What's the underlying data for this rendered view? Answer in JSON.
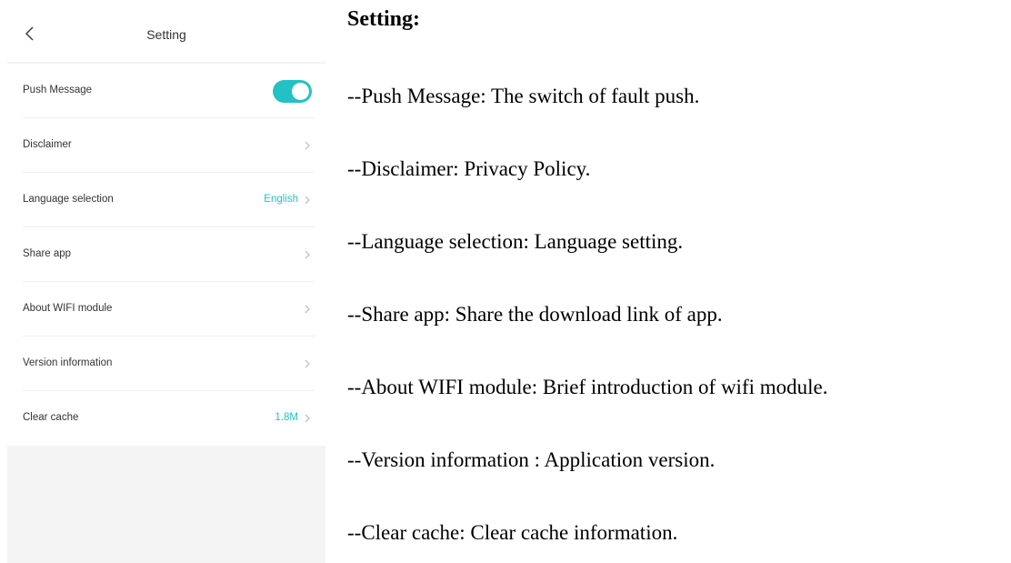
{
  "phone": {
    "nav": {
      "back_icon": "chevron-left-icon",
      "title": "Setting"
    },
    "accent_color": "#23c1c4",
    "rows": [
      {
        "label": "Push Message",
        "control": "toggle",
        "toggle_on": true
      },
      {
        "label": "Disclaimer",
        "value": ""
      },
      {
        "label": "Language selection",
        "value": "English"
      },
      {
        "label": "Share app",
        "value": ""
      },
      {
        "label": "About WIFI module",
        "value": ""
      },
      {
        "label": "Version information",
        "value": ""
      },
      {
        "label": "Clear cache",
        "value": "1.8M"
      }
    ]
  },
  "description": {
    "heading": "Setting:",
    "lines": [
      "--Push Message: The switch of fault push.",
      "--Disclaimer: Privacy Policy.",
      "--Language selection: Language setting.",
      "--Share app: Share the download link of app.",
      "--About WIFI module: Brief introduction of wifi module.",
      "--Version information : Application version.",
      "--Clear cache: Clear cache information."
    ]
  }
}
